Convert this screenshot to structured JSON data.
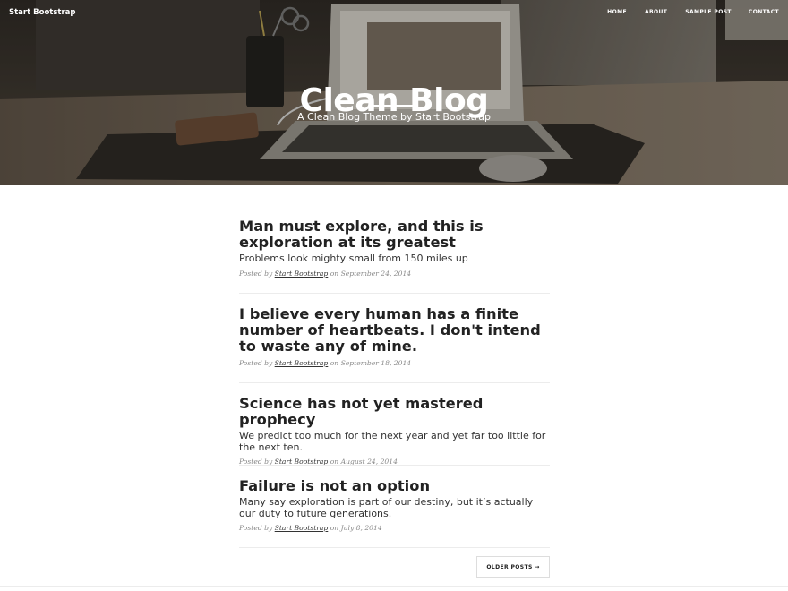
{
  "navbar": {
    "brand": "Start Bootstrap",
    "links": [
      "HOME",
      "ABOUT",
      "SAMPLE POST",
      "CONTACT"
    ]
  },
  "hero": {
    "title": "Clean Blog",
    "subtitle": "A Clean Blog Theme by Start Bootstrap"
  },
  "posts": [
    {
      "title": "Man must explore, and this is exploration at its greatest",
      "subtitle": "Problems look mighty small from 150 miles up",
      "posted_by": "Posted by",
      "author": "Start Bootstrap",
      "on": "on",
      "date": "September 24, 2014"
    },
    {
      "title": "I believe every human has a finite number of heartbeats. I don't intend to waste any of mine.",
      "subtitle": "",
      "posted_by": "Posted by",
      "author": "Start Bootstrap",
      "on": "on",
      "date": "September 18, 2014"
    },
    {
      "title": "Science has not yet mastered prophecy",
      "subtitle": "We predict too much for the next year and yet far too little for the next ten.",
      "posted_by": "Posted by",
      "author": "Start Bootstrap",
      "on": "on",
      "date": "August 24, 2014"
    },
    {
      "title": "Failure is not an option",
      "subtitle": "Many say exploration is part of our destiny, but it’s actually our duty to future generations.",
      "posted_by": "Posted by",
      "author": "Start Bootstrap",
      "on": "on",
      "date": "July 8, 2014"
    }
  ],
  "pager": {
    "older_label": "OLDER POSTS →"
  },
  "colors": {
    "text": "#222222",
    "meta": "#888888",
    "divider": "#ececec"
  }
}
